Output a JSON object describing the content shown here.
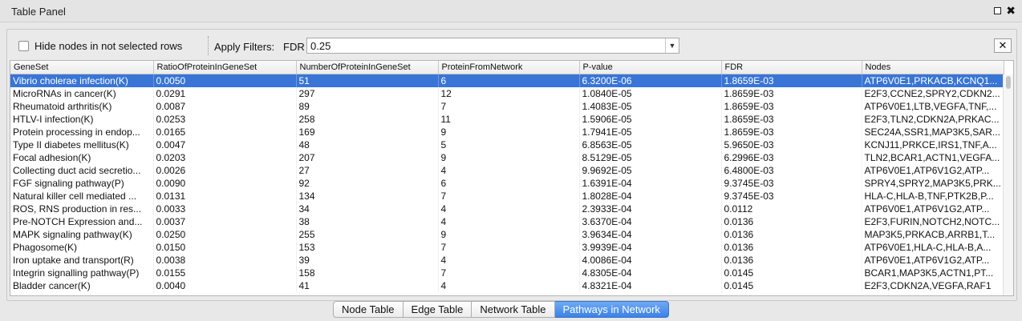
{
  "window": {
    "title": "Table Panel"
  },
  "toolbar": {
    "hide_nodes_label": "Hide nodes in not selected rows",
    "apply_filters_label": "Apply Filters:",
    "filter_column": "FDR",
    "filter_value": "0.25",
    "clear_label": "✕"
  },
  "table": {
    "columns": [
      "GeneSet",
      "RatioOfProteinInGeneSet",
      "NumberOfProteinInGeneSet",
      "ProteinFromNetwork",
      "P-value",
      "FDR",
      "Nodes"
    ],
    "selected_row": 0,
    "rows": [
      [
        "Vibrio cholerae infection(K)",
        "0.0050",
        "51",
        "6",
        "6.3200E-06",
        "1.8659E-03",
        "ATP6V0E1,PRKACB,KCNQ1..."
      ],
      [
        "MicroRNAs in cancer(K)",
        "0.0291",
        "297",
        "12",
        "1.0840E-05",
        "1.8659E-03",
        "E2F3,CCNE2,SPRY2,CDKN2..."
      ],
      [
        "Rheumatoid arthritis(K)",
        "0.0087",
        "89",
        "7",
        "1.4083E-05",
        "1.8659E-03",
        "ATP6V0E1,LTB,VEGFA,TNF,..."
      ],
      [
        "HTLV-I infection(K)",
        "0.0253",
        "258",
        "11",
        "1.5906E-05",
        "1.8659E-03",
        "E2F3,TLN2,CDKN2A,PRKAC..."
      ],
      [
        "Protein processing in endop...",
        "0.0165",
        "169",
        "9",
        "1.7941E-05",
        "1.8659E-03",
        "SEC24A,SSR1,MAP3K5,SAR..."
      ],
      [
        "Type II diabetes mellitus(K)",
        "0.0047",
        "48",
        "5",
        "6.8563E-05",
        "5.9650E-03",
        "KCNJ11,PRKCE,IRS1,TNF,A..."
      ],
      [
        "Focal adhesion(K)",
        "0.0203",
        "207",
        "9",
        "8.5129E-05",
        "6.2996E-03",
        "TLN2,BCAR1,ACTN1,VEGFA..."
      ],
      [
        "Collecting duct acid secretio...",
        "0.0026",
        "27",
        "4",
        "9.9692E-05",
        "6.4800E-03",
        "ATP6V0E1,ATP6V1G2,ATP..."
      ],
      [
        "FGF signaling pathway(P)",
        "0.0090",
        "92",
        "6",
        "1.6391E-04",
        "9.3745E-03",
        "SPRY4,SPRY2,MAP3K5,PRK..."
      ],
      [
        "Natural killer cell mediated ...",
        "0.0131",
        "134",
        "7",
        "1.8028E-04",
        "9.3745E-03",
        "HLA-C,HLA-B,TNF,PTK2B,P..."
      ],
      [
        "ROS, RNS production in res...",
        "0.0033",
        "34",
        "4",
        "2.3933E-04",
        "0.0112",
        "ATP6V0E1,ATP6V1G2,ATP..."
      ],
      [
        "Pre-NOTCH Expression and...",
        "0.0037",
        "38",
        "4",
        "3.6370E-04",
        "0.0136",
        "E2F3,FURIN,NOTCH2,NOTC..."
      ],
      [
        "MAPK signaling pathway(K)",
        "0.0250",
        "255",
        "9",
        "3.9634E-04",
        "0.0136",
        "MAP3K5,PRKACB,ARRB1,T..."
      ],
      [
        "Phagosome(K)",
        "0.0150",
        "153",
        "7",
        "3.9939E-04",
        "0.0136",
        "ATP6V0E1,HLA-C,HLA-B,A..."
      ],
      [
        "Iron uptake and transport(R)",
        "0.0038",
        "39",
        "4",
        "4.0086E-04",
        "0.0136",
        "ATP6V0E1,ATP6V1G2,ATP..."
      ],
      [
        "Integrin signalling pathway(P)",
        "0.0155",
        "158",
        "7",
        "4.8305E-04",
        "0.0145",
        "BCAR1,MAP3K5,ACTN1,PT..."
      ],
      [
        "Bladder cancer(K)",
        "0.0040",
        "41",
        "4",
        "4.8321E-04",
        "0.0145",
        "E2F3,CDKN2A,VEGFA,RAF1"
      ]
    ]
  },
  "tabs": [
    {
      "label": "Node Table",
      "active": false
    },
    {
      "label": "Edge Table",
      "active": false
    },
    {
      "label": "Network Table",
      "active": false
    },
    {
      "label": "Pathways in Network",
      "active": true
    }
  ]
}
